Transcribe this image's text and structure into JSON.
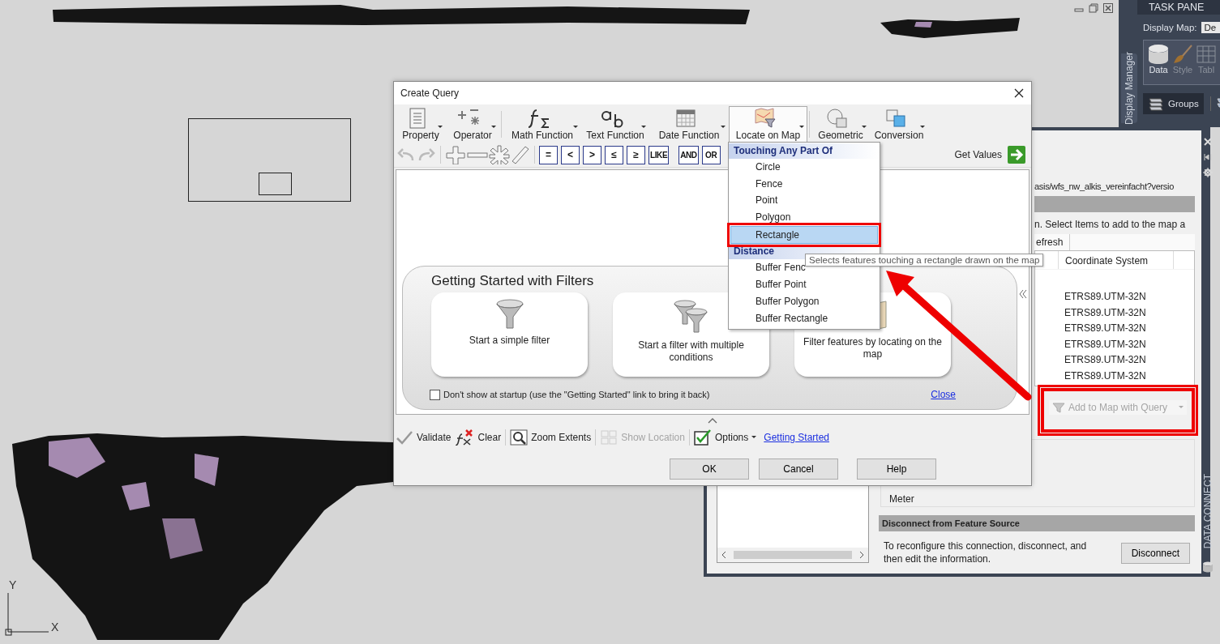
{
  "map": {
    "axis_y": "Y",
    "axis_x": "X"
  },
  "task_pane": {
    "title": "TASK PANE",
    "side_tab": "Display Manager",
    "display_map_label": "Display Map:",
    "display_map_value": "De",
    "tools": [
      {
        "label": "Data",
        "disabled": false
      },
      {
        "label": "Style",
        "disabled": true
      },
      {
        "label": "Tabl",
        "disabled": true
      }
    ],
    "groups_button": {
      "label": "Groups",
      "selected": true
    }
  },
  "data_connect": {
    "side_title": "DATA CONNECT",
    "url": "asis/wfs_nw_alkis_vereinfacht?versio",
    "instructions": "n.  Select Items to add to the map a",
    "refresh_button": "efresh",
    "table": {
      "columns": [
        "Coordinate System"
      ],
      "rows": [
        "ETRS89.UTM-32N",
        "ETRS89.UTM-32N",
        "ETRS89.UTM-32N",
        "ETRS89.UTM-32N",
        "ETRS89.UTM-32N",
        "ETRS89.UTM-32N"
      ]
    },
    "add_button": {
      "label": "Add to Map with Query",
      "disabled": true,
      "highlighted": true
    },
    "units_value": "Meter",
    "disconnect": {
      "header": "Disconnect from Feature Source",
      "text": "To reconfigure this connection, disconnect, and then edit the information.",
      "button": "Disconnect"
    }
  },
  "dialog": {
    "title": "Create Query",
    "toolbar": [
      {
        "label": "Property",
        "selected": false
      },
      {
        "label": "Operator",
        "selected": false
      },
      {
        "label": "Math Function",
        "selected": false
      },
      {
        "label": "Text Function",
        "selected": false
      },
      {
        "label": "Date Function",
        "selected": false
      },
      {
        "label": "Locate on Map",
        "selected": true
      },
      {
        "label": "Geometric",
        "selected": false
      },
      {
        "label": "Conversion",
        "selected": false
      }
    ],
    "operator_keys": [
      "=",
      "<",
      ">",
      "≤",
      "≥",
      "LIKE",
      "AND",
      "OR"
    ],
    "get_values_button": "Get Values",
    "getting_started": {
      "title": "Getting Started with Filters",
      "cards": [
        "Start a simple filter",
        "Start a filter with multiple conditions",
        "Filter features by locating on the map"
      ],
      "dont_show": {
        "label": "Don't show at startup (use the \"Getting Started\" link to bring it back)",
        "checked": false
      },
      "close_link": "Close"
    },
    "bottom_tools": [
      {
        "label": "Validate",
        "disabled": false
      },
      {
        "label": "Clear",
        "disabled": false
      },
      {
        "label": "Zoom Extents",
        "disabled": false
      },
      {
        "label": "Show Location",
        "disabled": true
      },
      {
        "label": "Options",
        "disabled": false
      }
    ],
    "getting_started_link": "Getting Started",
    "buttons": [
      "OK",
      "Cancel",
      "Help"
    ]
  },
  "locate_menu": {
    "items": [
      {
        "kind": "header",
        "label": "Touching Any Part Of",
        "selected": false,
        "highlighted": false
      },
      {
        "kind": "item",
        "label": "Circle",
        "selected": false,
        "highlighted": false
      },
      {
        "kind": "item",
        "label": "Fence",
        "selected": false,
        "highlighted": false
      },
      {
        "kind": "item",
        "label": "Point",
        "selected": false,
        "highlighted": false
      },
      {
        "kind": "item",
        "label": "Polygon",
        "selected": false,
        "highlighted": false
      },
      {
        "kind": "item",
        "label": "Rectangle",
        "selected": true,
        "highlighted": true
      },
      {
        "kind": "header",
        "label": "Distance",
        "selected": false,
        "highlighted": false
      },
      {
        "kind": "item",
        "label": "Buffer Fenc",
        "selected": false,
        "highlighted": false
      },
      {
        "kind": "item",
        "label": "Buffer Point",
        "selected": false,
        "highlighted": false
      },
      {
        "kind": "item",
        "label": "Buffer Polygon",
        "selected": false,
        "highlighted": false
      },
      {
        "kind": "item",
        "label": "Buffer Rectangle",
        "selected": false,
        "highlighted": false
      }
    ]
  },
  "tooltip": "Selects features touching a rectangle drawn on the map"
}
